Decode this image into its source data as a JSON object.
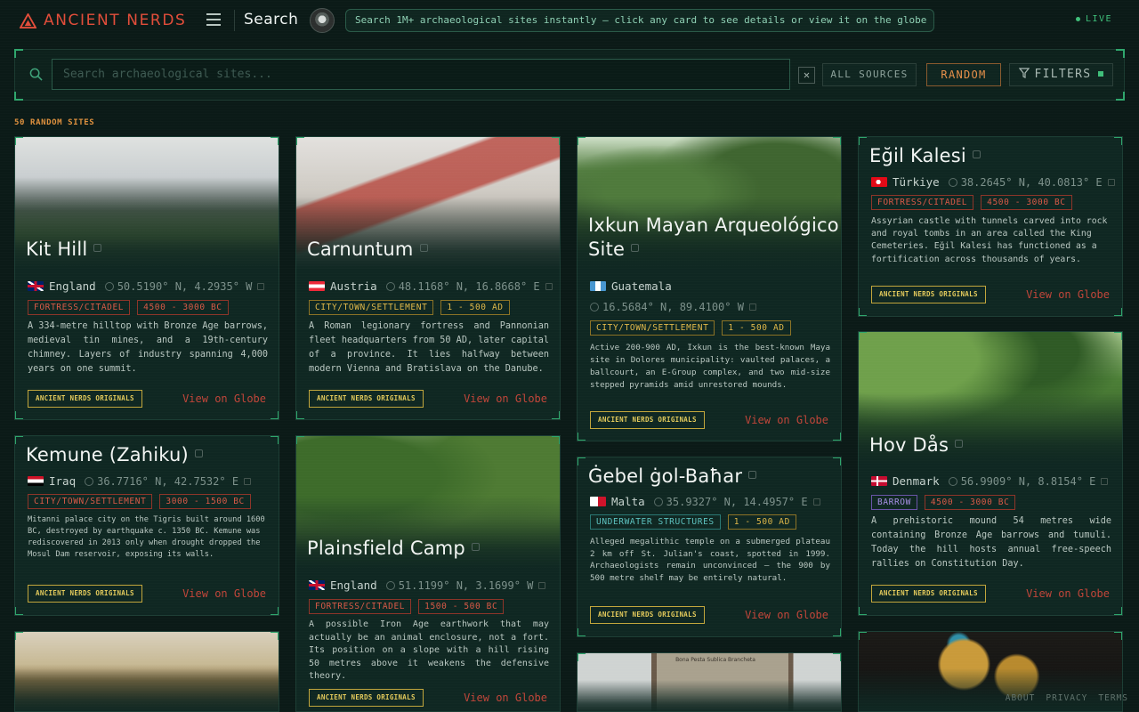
{
  "app": {
    "brand": "ANCIENT NERDS",
    "page_title": "Search",
    "hint": "Search 1M+ archaeological sites instantly — click any card to see details or view it on the globe",
    "live_label": "LIVE",
    "accent": "#e24d3a",
    "highlight": "#2fa66c"
  },
  "search": {
    "placeholder": "Search archaeological sites...",
    "value": "",
    "clear_label": "✕",
    "sources_label": "ALL SOURCES",
    "random_label": "RANDOM",
    "filters_label": "FILTERS"
  },
  "results": {
    "label": "50 RANDOM SITES"
  },
  "cards": [
    {
      "title": "Kit Hill",
      "country": "England",
      "coords": "50.5190° N, 4.2935° W",
      "tags": [
        "FORTRESS/CITADEL",
        "4500 - 3000 BC"
      ],
      "desc": "A 334-metre hilltop with Bronze Age barrows, medieval tin mines, and a 19th-century chimney. Layers of industry spanning 4,000 years on one summit.",
      "badge": "ANCIENT NERDS ORIGINALS",
      "link": "View on Globe"
    },
    {
      "title": "Carnuntum",
      "country": "Austria",
      "coords": "48.1168° N, 16.8668° E",
      "tags": [
        "CITY/TOWN/SETTLEMENT",
        "1 - 500 AD"
      ],
      "desc": "A Roman legionary fortress and Pannonian fleet headquarters from 50 AD, later capital of a province. It lies halfway between modern Vienna and Bratislava on the Danube.",
      "badge": "ANCIENT NERDS ORIGINALS",
      "link": "View on Globe"
    },
    {
      "title": "Ixkun Mayan Arqueológico Site",
      "country": "Guatemala",
      "coords": "16.5684° N, 89.4100° W",
      "tags": [
        "CITY/TOWN/SETTLEMENT",
        "1 - 500 AD"
      ],
      "desc": "Active 200-900 AD, Ixkun is the best-known Maya site in Dolores municipality: vaulted palaces, a ballcourt, an E-Group complex, and two mid-size stepped pyramids amid unrestored mounds.",
      "badge": "ANCIENT NERDS ORIGINALS",
      "link": "View on Globe"
    },
    {
      "title": "Eğil Kalesi",
      "country": "Türkiye",
      "coords": "38.2645° N, 40.0813° E",
      "tags": [
        "FORTRESS/CITADEL",
        "4500 - 3000 BC"
      ],
      "desc": "Assyrian castle with tunnels carved into rock and royal tombs in an area called the King Cemeteries. Eğil Kalesi has functioned as a fortification across thousands of years.",
      "badge": "ANCIENT NERDS ORIGINALS",
      "link": "View on Globe"
    },
    {
      "title": "Kemune (Zahiku)",
      "country": "Iraq",
      "coords": "36.7716° N, 42.7532° E",
      "tags": [
        "CITY/TOWN/SETTLEMENT",
        "3000 - 1500 BC"
      ],
      "desc": "Mitanni palace city on the Tigris built around 1600 BC, destroyed by earthquake c. 1350 BC. Kemune was rediscovered in 2013 only when drought dropped the Mosul Dam reservoir, exposing its walls.",
      "badge": "ANCIENT NERDS ORIGINALS",
      "link": "View on Globe"
    },
    {
      "title": "Plainsfield Camp",
      "country": "England",
      "coords": "51.1199° N, 3.1699° W",
      "tags": [
        "FORTRESS/CITADEL",
        "1500 - 500 BC"
      ],
      "desc": "A possible Iron Age earthwork that may actually be an animal enclosure, not a fort. Its position on a slope with a hill rising 50 metres above it weakens the defensive theory.",
      "badge": "ANCIENT NERDS ORIGINALS",
      "link": "View on Globe"
    },
    {
      "title": "Ġebel ġol-Baħar",
      "country": "Malta",
      "coords": "35.9327° N, 14.4957° E",
      "tags": [
        "UNDERWATER STRUCTURES",
        "1 - 500 AD"
      ],
      "desc": "Alleged megalithic temple on a submerged plateau 2 km off St. Julian's coast, spotted in 1999. Archaeologists remain unconvinced — the 900 by 500 metre shelf may be entirely natural.",
      "badge": "ANCIENT NERDS ORIGINALS",
      "link": "View on Globe"
    },
    {
      "title": "Hov Dås",
      "country": "Denmark",
      "coords": "56.9909° N, 8.8154° E",
      "tags": [
        "BARROW",
        "4500 - 3000 BC"
      ],
      "desc": "A prehistoric mound 54 metres wide containing Bronze Age barrows and tumuli. Today the hill hosts annual free-speech rallies on Constitution Day.",
      "badge": "ANCIENT NERDS ORIGINALS",
      "link": "View on Globe"
    }
  ],
  "partial_card": {
    "image_caption": "Bona Pesta Sublica Brancheta"
  },
  "footer": [
    "ABOUT",
    "PRIVACY",
    "TERMS"
  ]
}
